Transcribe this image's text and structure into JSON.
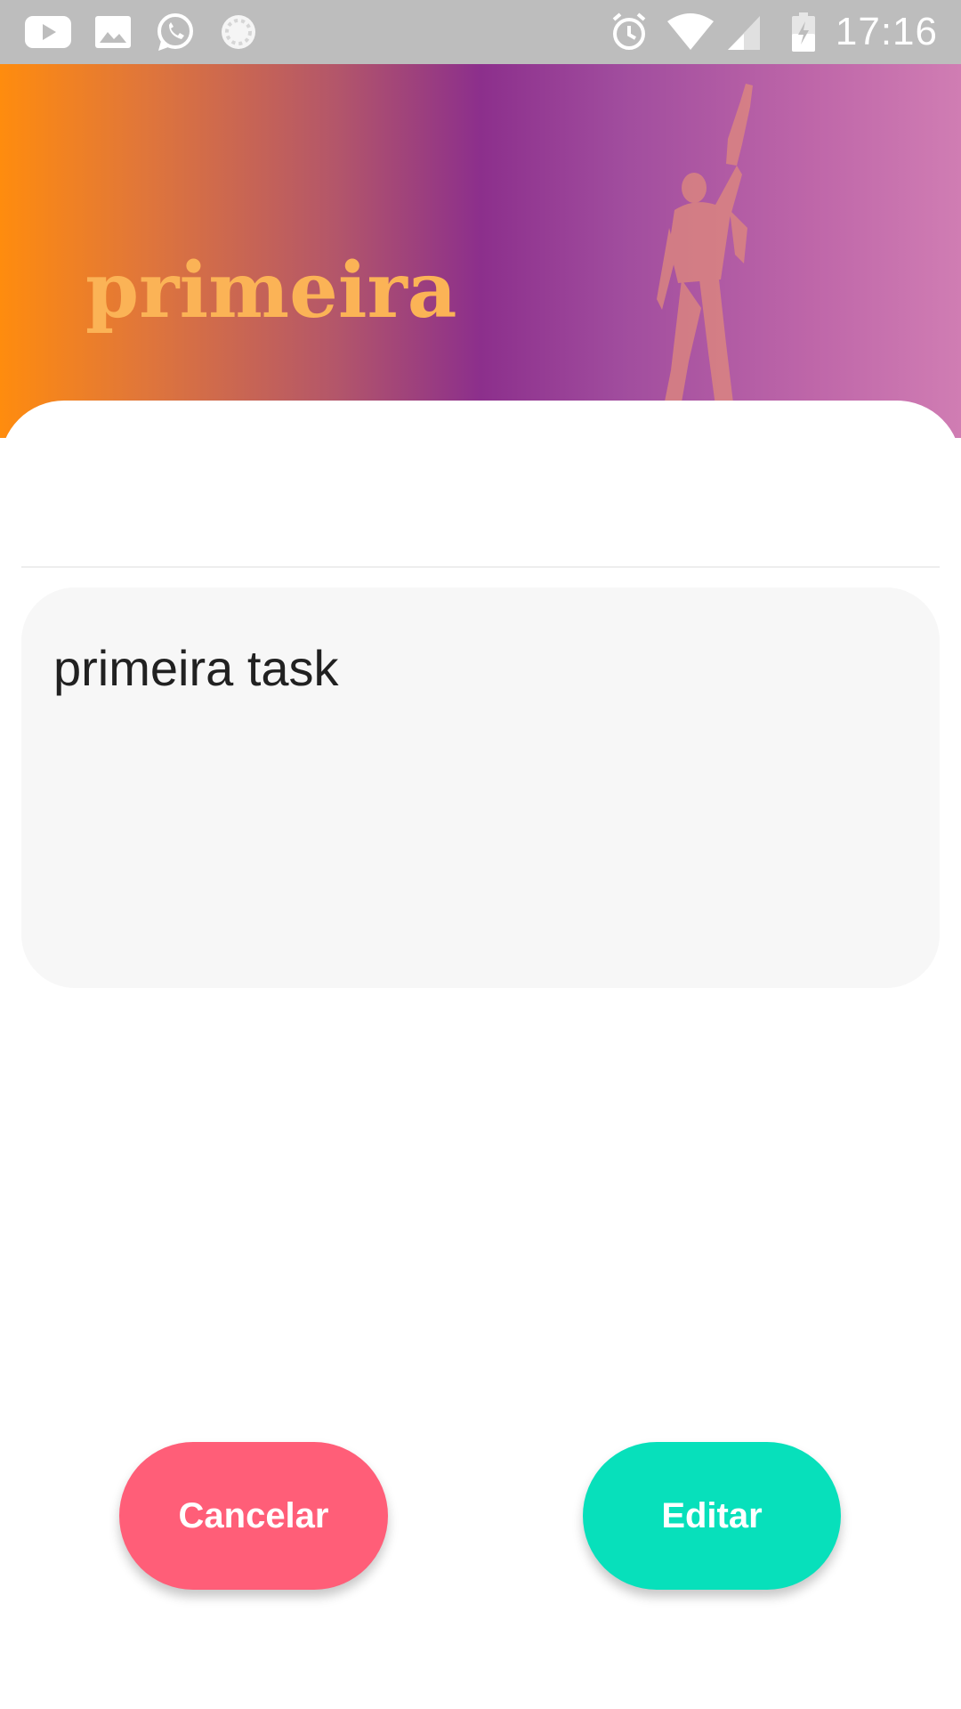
{
  "status_bar": {
    "time": "17:16",
    "left_icons": [
      "youtube-icon",
      "gallery-icon",
      "whatsapp-icon",
      "sync-icon"
    ],
    "right_icons": [
      "alarm-icon",
      "wifi-icon",
      "cellular-signal-icon",
      "battery-charging-icon"
    ]
  },
  "header": {
    "title": "primeira",
    "background_colors": [
      "#ff8c0e",
      "#8c2f8c",
      "#d07db3"
    ],
    "title_color": "#fbb356"
  },
  "task": {
    "text": "primeira task"
  },
  "buttons": {
    "cancel_label": "Cancelar",
    "edit_label": "Editar",
    "cancel_color": "#ff5e78",
    "edit_color": "#07e0bb"
  }
}
